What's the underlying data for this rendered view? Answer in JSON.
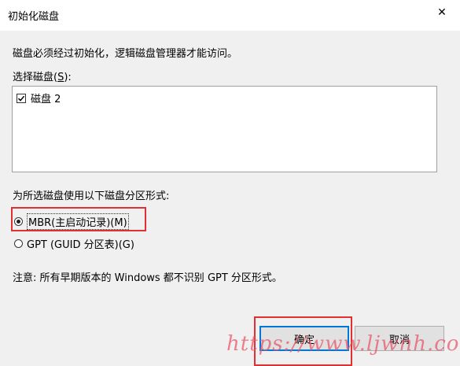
{
  "window": {
    "title": "初始化磁盘",
    "close_glyph": "✕"
  },
  "description": "磁盘必须经过初始化，逻辑磁盘管理器才能访问。",
  "disk_select": {
    "label": "选择磁盘(",
    "label_access_key": "S",
    "label_end": "):",
    "items": [
      {
        "label": "磁盘 2",
        "checked": true
      }
    ]
  },
  "partition_style": {
    "label": "为所选磁盘使用以下磁盘分区形式:",
    "options": [
      {
        "label": "MBR(主启动记录)(M)",
        "selected": true
      },
      {
        "label": "GPT (GUID 分区表)(G)",
        "selected": false
      }
    ]
  },
  "note": "注意: 所有早期版本的 Windows 都不识别 GPT 分区形式。",
  "buttons": {
    "ok_label": "确定",
    "cancel_label": "取消"
  },
  "watermark": "https://www.ljwnh.com",
  "colors": {
    "highlight_red": "#e23030",
    "default_button_border": "#0078d7",
    "dialog_background": "#f0f0f0"
  }
}
